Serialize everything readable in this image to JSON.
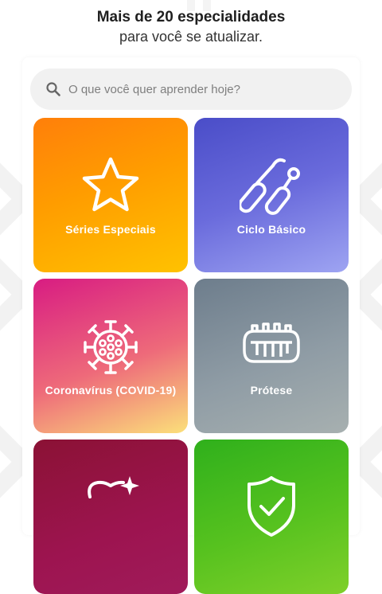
{
  "header": {
    "title": "Mais de 20 especialidades",
    "subtitle": "para você se atualizar."
  },
  "search": {
    "placeholder": "O que você quer aprender hoje?",
    "icon": "search-icon"
  },
  "categories": [
    {
      "label": "Séries Especiais",
      "icon": "star-icon",
      "colors": [
        "#ff7f0a",
        "#ffc200"
      ]
    },
    {
      "label": "Ciclo Básico",
      "icon": "dental-tools-icon",
      "colors": [
        "#4a4dc8",
        "#9ea4f2"
      ]
    },
    {
      "label": "Coronavírus (COVID-19)",
      "icon": "virus-icon",
      "colors": [
        "#d81c82",
        "#fbe07a"
      ]
    },
    {
      "label": "Prótese",
      "icon": "denture-icon",
      "colors": [
        "#6d7d8c",
        "#a7b0b0"
      ]
    },
    {
      "label": "",
      "icon": "tooth-sparkle-icon",
      "colors": [
        "#8b1235",
        "#a01b5a"
      ]
    },
    {
      "label": "",
      "icon": "shield-check-icon",
      "colors": [
        "#2fb01c",
        "#7fd02a"
      ]
    }
  ]
}
